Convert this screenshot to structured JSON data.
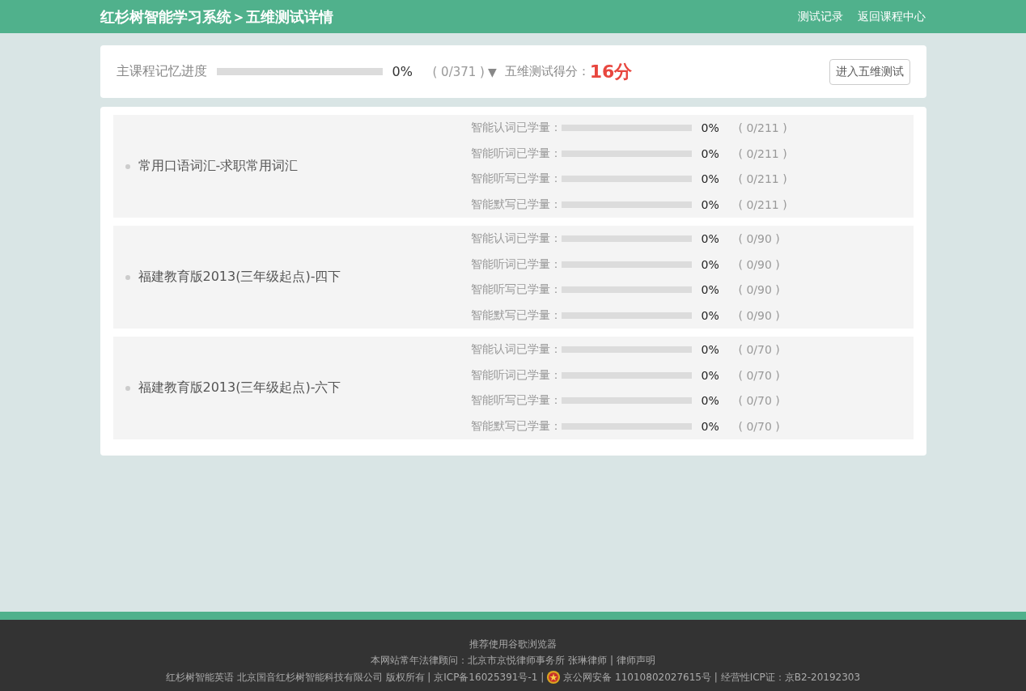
{
  "header": {
    "title": "红杉树智能学习系统＞五维测试详情",
    "links": [
      "测试记录",
      "返回课程中心"
    ]
  },
  "summary": {
    "label": "主课程记忆进度",
    "level": 0,
    "percent": "0%",
    "count": "( 0/371 )",
    "toggle": "▼",
    "score_label": "五维测试得分：",
    "score": "16分",
    "button": "进入五维测试"
  },
  "courses": [
    {
      "name": "常用口语词汇-求职常用词汇",
      "stats": [
        {
          "label": "智能认词已学量：",
          "level": 0,
          "percent": "0%",
          "count": "( 0/211 )"
        },
        {
          "label": "智能听词已学量：",
          "level": 0,
          "percent": "0%",
          "count": "( 0/211 )"
        },
        {
          "label": "智能听写已学量：",
          "level": 0,
          "percent": "0%",
          "count": "( 0/211 )"
        },
        {
          "label": "智能默写已学量：",
          "level": 0,
          "percent": "0%",
          "count": "( 0/211 )"
        }
      ]
    },
    {
      "name": "福建教育版2013(三年级起点)-四下",
      "stats": [
        {
          "label": "智能认词已学量：",
          "level": 0,
          "percent": "0%",
          "count": "( 0/90 )"
        },
        {
          "label": "智能听词已学量：",
          "level": 0,
          "percent": "0%",
          "count": "( 0/90 )"
        },
        {
          "label": "智能听写已学量：",
          "level": 0,
          "percent": "0%",
          "count": "( 0/90 )"
        },
        {
          "label": "智能默写已学量：",
          "level": 0,
          "percent": "0%",
          "count": "( 0/90 )"
        }
      ]
    },
    {
      "name": "福建教育版2013(三年级起点)-六下",
      "stats": [
        {
          "label": "智能认词已学量：",
          "level": 0,
          "percent": "0%",
          "count": "( 0/70 )"
        },
        {
          "label": "智能听词已学量：",
          "level": 0,
          "percent": "0%",
          "count": "( 0/70 )"
        },
        {
          "label": "智能听写已学量：",
          "level": 0,
          "percent": "0%",
          "count": "( 0/70 )"
        },
        {
          "label": "智能默写已学量：",
          "level": 0,
          "percent": "0%",
          "count": "( 0/70 )"
        }
      ]
    }
  ],
  "footer": {
    "line_1": "推荐使用谷歌浏览器",
    "line_2": "本网站常年法律顾问：北京市京悦律师事务所 张琳律师 | 律师声明",
    "line_3_start": "红杉树智能英语 北京国音红杉树智能科技有限公司 版权所有 | 京ICP备16025391号-1 |",
    "line_3_end": "京公网安备 11010802027615号  | 经营性ICP证：京B2-20192303"
  }
}
